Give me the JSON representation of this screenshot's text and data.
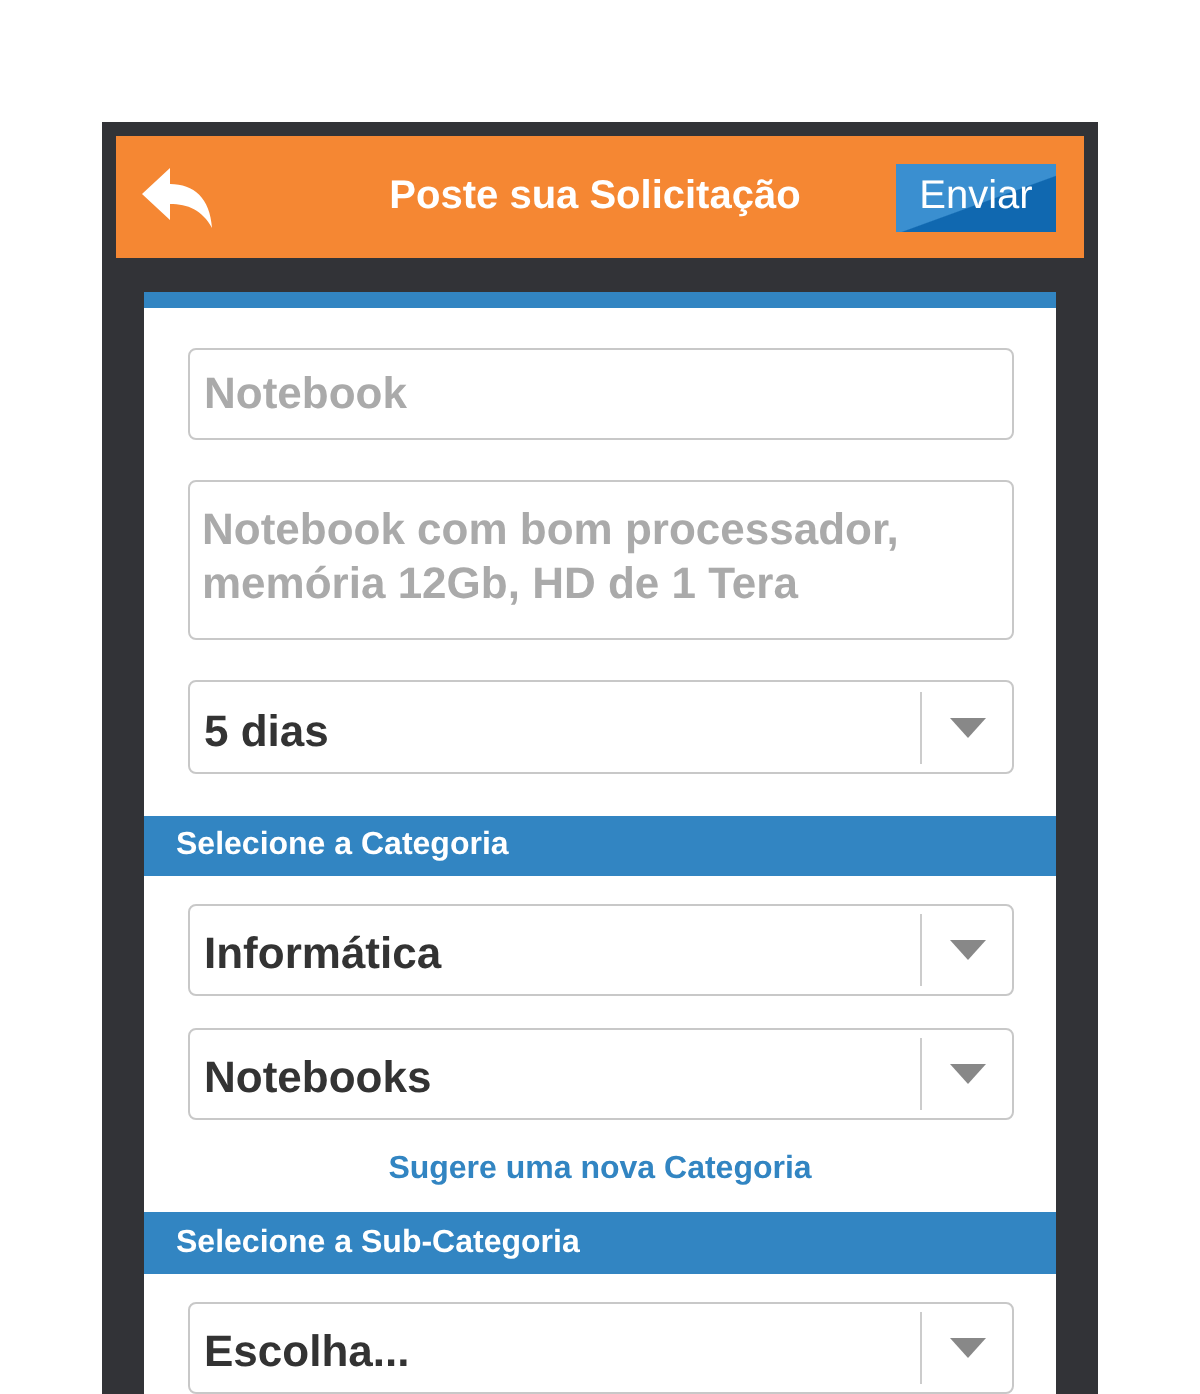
{
  "header": {
    "title": "Poste sua Solicitação",
    "action": "Enviar"
  },
  "form": [
    {
      "kind": "input",
      "placeholder": "Notebook"
    },
    {
      "kind": "textarea",
      "placeholder": "Notebook com bom processador, memória 12Gb, HD de 1 Tera"
    },
    {
      "kind": "select",
      "value": "5 dias"
    },
    {
      "kind": "section",
      "title": "Selecione a Categoria"
    },
    {
      "kind": "select",
      "value": "Informática"
    },
    {
      "kind": "select",
      "value": "Notebooks"
    },
    {
      "kind": "link",
      "text": "Sugere uma nova Categoria"
    },
    {
      "kind": "section",
      "title": "Selecione a Sub-Categoria"
    },
    {
      "kind": "select",
      "value": "Escolha..."
    }
  ]
}
